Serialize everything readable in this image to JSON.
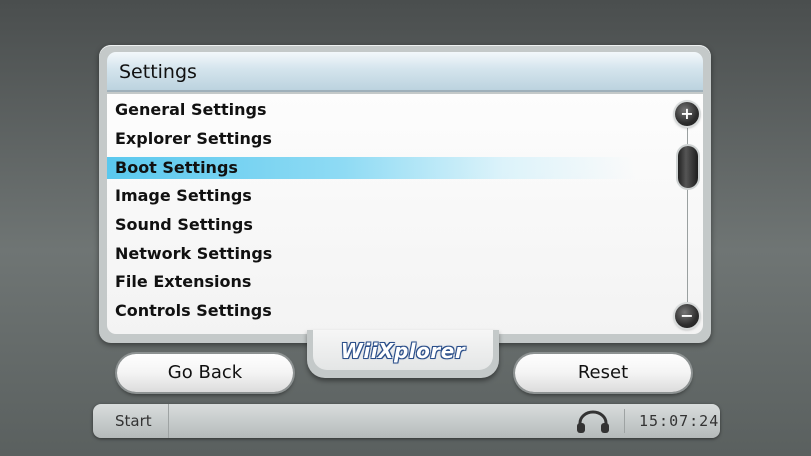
{
  "window": {
    "title": "Settings"
  },
  "settings_list": {
    "items": [
      {
        "label": "General Settings",
        "selected": false
      },
      {
        "label": "Explorer Settings",
        "selected": false
      },
      {
        "label": "Boot Settings",
        "selected": true
      },
      {
        "label": "Image Settings",
        "selected": false
      },
      {
        "label": "Sound Settings",
        "selected": false
      },
      {
        "label": "Network Settings",
        "selected": false
      },
      {
        "label": "File Extensions",
        "selected": false
      },
      {
        "label": "Controls Settings",
        "selected": false
      }
    ],
    "scroll_up_symbol": "+",
    "scroll_down_symbol": "−"
  },
  "logo": {
    "text": "WiiXplorer"
  },
  "buttons": {
    "back_label": "Go Back",
    "reset_label": "Reset"
  },
  "taskbar": {
    "start_label": "Start",
    "audio_icon": "headphones-icon",
    "clock": "15:07:24"
  },
  "colors": {
    "selection": "#5ac8ee",
    "logo_outline": "#2b4f8a",
    "panel": "#c4c9c9"
  }
}
